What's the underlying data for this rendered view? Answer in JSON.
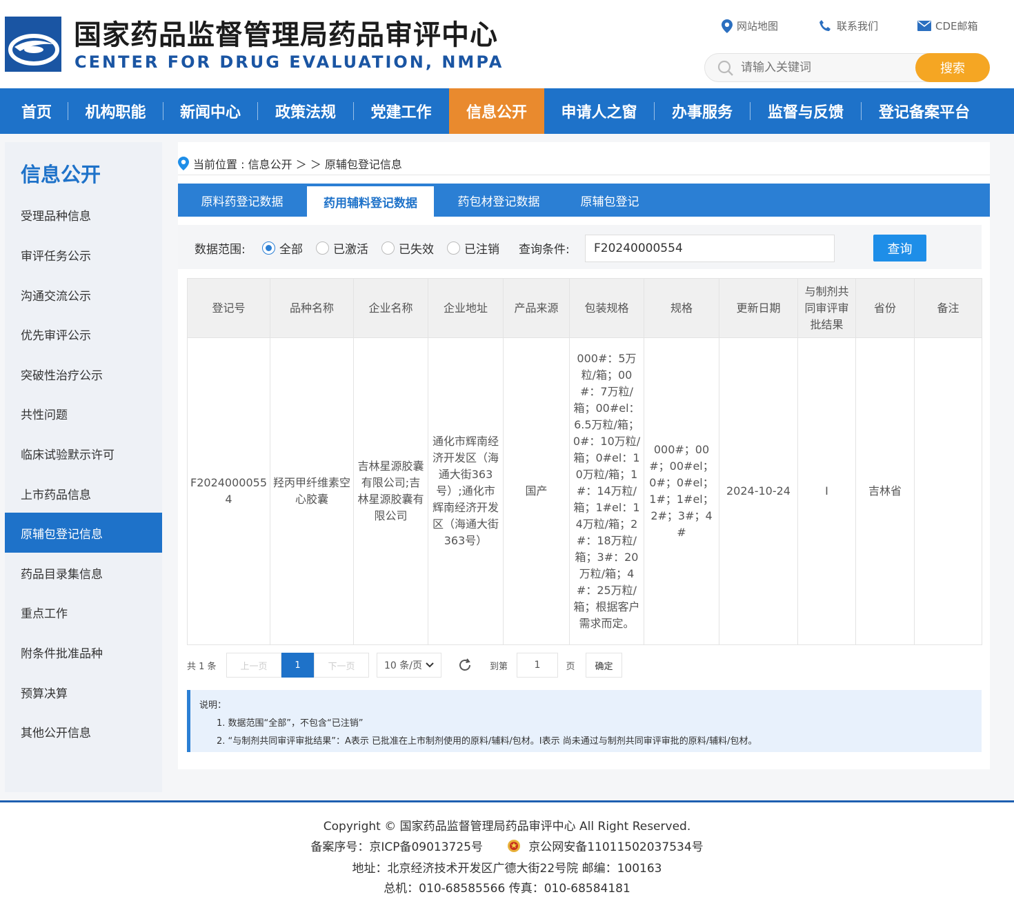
{
  "header": {
    "title_cn": "国家药品监督管理局药品审评中心",
    "title_en": "CENTER FOR DRUG EVALUATION, NMPA",
    "links": [
      "网站地图",
      "联系我们",
      "CDE邮箱"
    ],
    "search_placeholder": "请输入关键词",
    "search_button": "搜索"
  },
  "nav": {
    "items": [
      "首页",
      "机构职能",
      "新闻中心",
      "政策法规",
      "党建工作",
      "信息公开",
      "申请人之窗",
      "办事服务",
      "监督与反馈",
      "登记备案平台"
    ],
    "active": "信息公开"
  },
  "sidebar": {
    "title": "信息公开",
    "items": [
      "受理品种信息",
      "审评任务公示",
      "沟通交流公示",
      "优先审评公示",
      "突破性治疗公示",
      "共性问题",
      "临床试验默示许可",
      "上市药品信息",
      "原辅包登记信息",
      "药品目录集信息",
      "重点工作",
      "附条件批准品种",
      "预算决算",
      "其他公开信息"
    ],
    "active": "原辅包登记信息"
  },
  "breadcrumb": {
    "text": "当前位置 : 信息公开 ＞ ＞ 原辅包登记信息"
  },
  "tabs": {
    "items": [
      "原料药登记数据",
      "药用辅料登记数据",
      "药包材登记数据",
      "原辅包登记"
    ],
    "active": "药用辅料登记数据"
  },
  "filter": {
    "range_label": "数据范围:",
    "options": [
      "全部",
      "已激活",
      "已失效",
      "已注销"
    ],
    "selected": "全部",
    "query_label": "查询条件:",
    "query_value": "F20240000554",
    "query_button": "查询"
  },
  "table": {
    "headers": [
      "登记号",
      "品种名称",
      "企业名称",
      "企业地址",
      "产品来源",
      "包装规格",
      "规格",
      "更新日期",
      "与制剂共同审评审批结果",
      "省份",
      "备注"
    ],
    "rows": [
      [
        "F20240000554",
        "羟丙甲纤维素空心胶囊",
        "吉林星源胶囊有限公司;吉林星源胶囊有限公司",
        "通化市辉南经济开发区（海通大街363号）;通化市辉南经济开发区（海通大街363号）",
        "国产",
        "000#：5万粒/箱；00#：7万粒/箱；00#el：6.5万粒/箱；0#：10万粒/箱；0#el：10万粒/箱；1#：14万粒/箱；1#el：14万粒/箱；2#：18万粒/箱；3#：20万粒/箱；4#：25万粒/箱；根据客户需求而定。",
        "000#；00#；00#el；0#；0#el；1#；1#el；2#；3#；4#",
        "2024-10-24",
        "I",
        "吉林省",
        ""
      ]
    ]
  },
  "pager": {
    "total": "共 1 条",
    "prev": "上一页",
    "current": "1",
    "next": "下一页",
    "page_size": "10 条/页",
    "goto_label": "到第",
    "goto_value": "1",
    "page_unit": "页",
    "confirm": "确定"
  },
  "notes": {
    "title": "说明：",
    "line1": "1. 数据范围“全部”，不包含“已注销”",
    "line2": "2. “与制剂共同审评审批结果”：A表示 已批准在上市制剂使用的原料/辅料/包材。I表示 尚未通过与制剂共同审评审批的原料/辅料/包材。"
  },
  "footer": {
    "copyright": "Copyright © 国家药品监督管理局药品审评中心    All Right Reserved.",
    "icp": "备案序号：京ICP备09013725号",
    "police": "京公网安备11011502037534号",
    "address": "地址：北京经济技术开发区广德大街22号院      邮编：100163",
    "phone": "总机：010-68585566      传真：010-68584181"
  },
  "colors": {
    "brand_blue": "#1e72c9",
    "nav_active": "#e98a2e",
    "search_button": "#f5a623"
  }
}
